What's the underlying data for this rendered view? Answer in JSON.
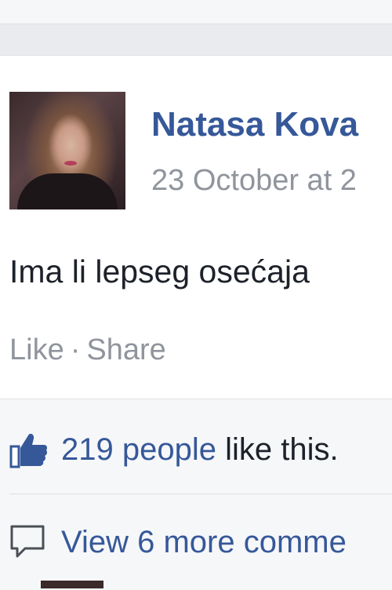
{
  "post": {
    "author": "Natasa Kova",
    "timestamp": "23 October at 2",
    "text": "Ima li lepseg osećaja",
    "actions": {
      "like": "Like",
      "separator": "·",
      "share": "Share"
    }
  },
  "reactions": {
    "likes_count": "219 people",
    "likes_suffix": " like this.",
    "comments_link": "View 6 more comme"
  },
  "icons": {
    "like": "thumbs-up-icon",
    "comment": "comment-bubble-icon"
  },
  "colors": {
    "link": "#365899",
    "muted": "#90949c",
    "text": "#1d2129"
  }
}
